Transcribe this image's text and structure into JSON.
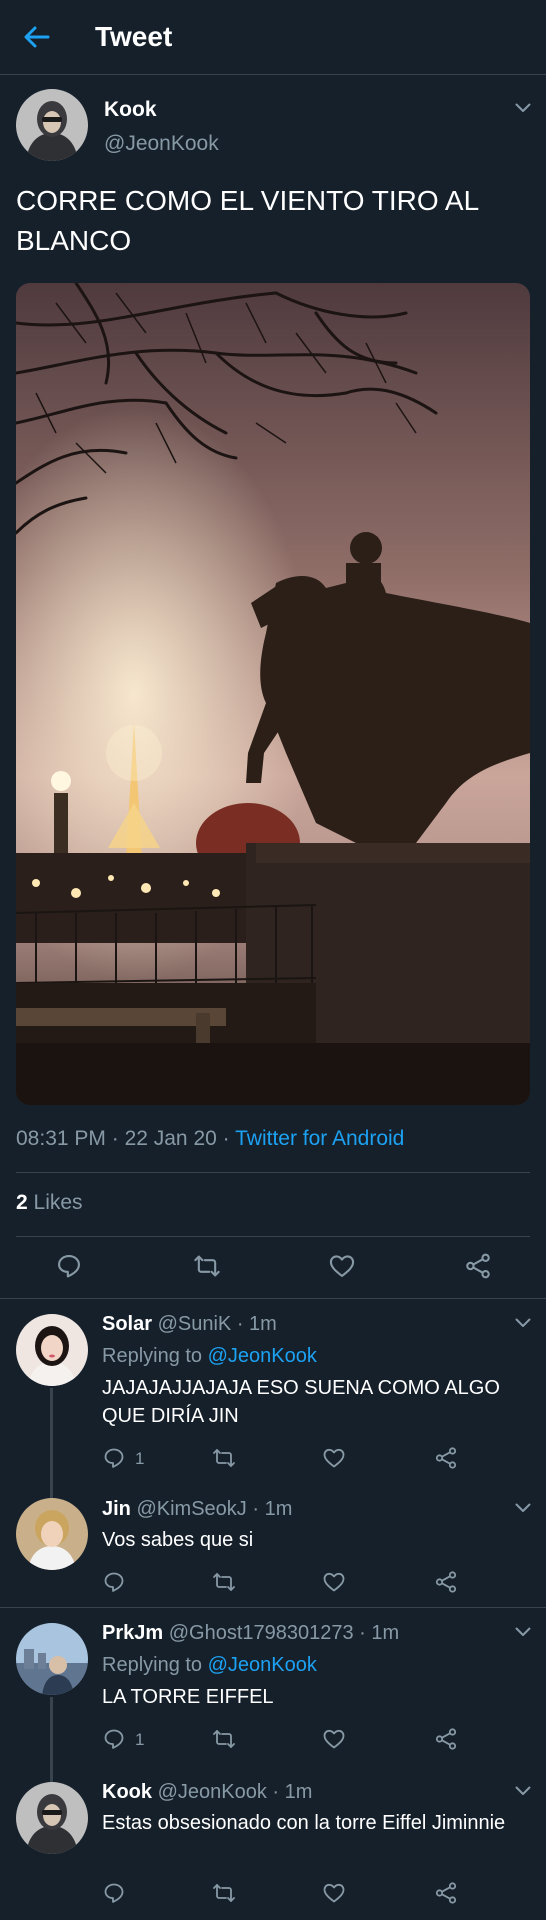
{
  "header": {
    "title": "Tweet"
  },
  "main_tweet": {
    "name": "Kook",
    "handle": "@JeonKook",
    "text": "CORRE COMO EL VIENTO TIRO AL BLANCO",
    "time": "08:31 PM",
    "date": "22 Jan 20",
    "source": "Twitter for Android",
    "likes_count": "2",
    "likes_label": "Likes"
  },
  "replies": [
    {
      "name": "Solar",
      "handle": "@SuniK",
      "time": "1m",
      "replying_label": "Replying to",
      "replying_to": "@JeonKook",
      "text": "JAJAJAJJAJAJA ESO SUENA COMO ALGO QUE DIRÍA JIN",
      "reply_count": "1"
    },
    {
      "name": "Jin",
      "handle": "@KimSeokJ",
      "time": "1m",
      "text": "Vos sabes que si"
    },
    {
      "name": "PrkJm",
      "handle": "@Ghost1798301273",
      "time": "1m",
      "replying_label": "Replying to",
      "replying_to": "@JeonKook",
      "text": "LA TORRE EIFFEL",
      "reply_count": "1"
    },
    {
      "name": "Kook",
      "handle": "@JeonKook",
      "time": "1m",
      "text": "Estas obsesionado con la torre Eiffel Jiminnie"
    }
  ],
  "colors": {
    "background": "#15202b",
    "accent": "#1da1f2",
    "muted": "#8899a6",
    "divider": "#38444d"
  },
  "icons": [
    "back-arrow-icon",
    "chevron-down-icon",
    "reply-icon",
    "retweet-icon",
    "like-icon",
    "share-icon"
  ]
}
